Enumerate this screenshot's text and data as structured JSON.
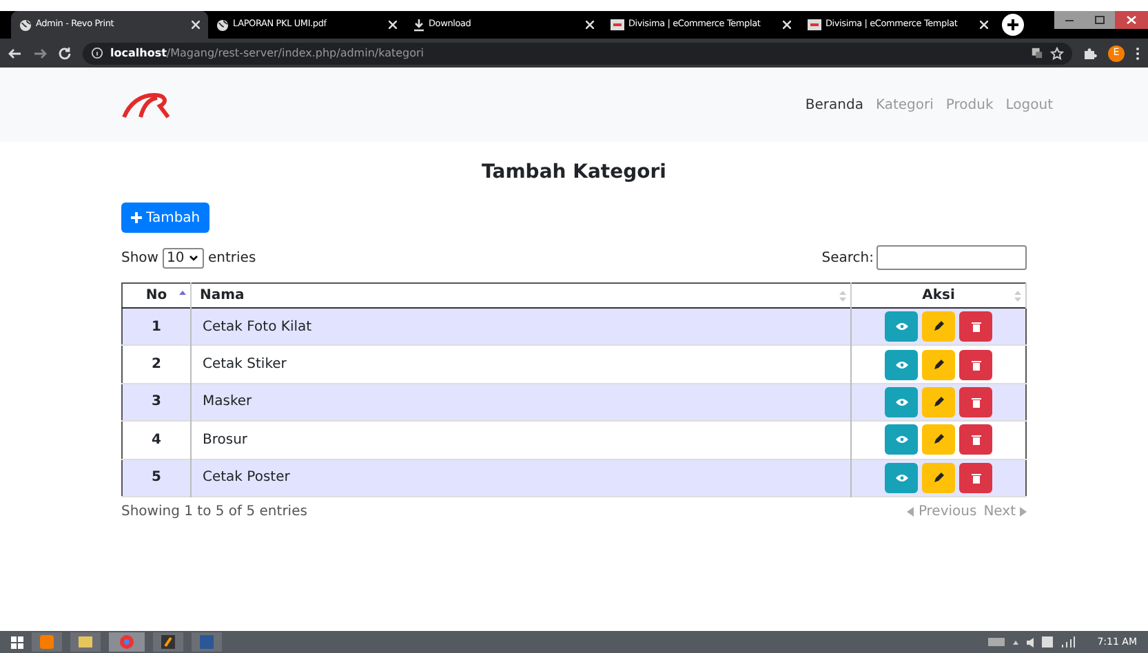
{
  "browser": {
    "tabs": [
      {
        "title": "Admin - Revo Print",
        "kind": "globe",
        "selected": true
      },
      {
        "title": "LAPORAN PKL UMI.pdf",
        "kind": "globe",
        "selected": false
      },
      {
        "title": "Download",
        "kind": "download",
        "selected": false
      },
      {
        "title": "Divisima | eCommerce Templat",
        "kind": "site",
        "selected": false
      },
      {
        "title": "Divisima | eCommerce Templat",
        "kind": "site",
        "selected": false
      }
    ],
    "url_host": "localhost",
    "url_path": "/Magang/rest-server/index.php/admin/kategori",
    "profile_initial": "E"
  },
  "navbar": {
    "links": [
      {
        "label": "Beranda",
        "selected": true
      },
      {
        "label": "Kategori",
        "selected": false
      },
      {
        "label": "Produk",
        "selected": false
      },
      {
        "label": "Logout",
        "selected": false
      }
    ]
  },
  "page_title": "Tambah Kategori",
  "add_button": "Tambah",
  "length": {
    "before": "Show",
    "value": "10",
    "after": "entries"
  },
  "search_label": "Search:",
  "table": {
    "columns": [
      "No",
      "Nama",
      "Aksi"
    ],
    "rows": [
      {
        "no": "1",
        "nama": "Cetak Foto Kilat"
      },
      {
        "no": "2",
        "nama": "Cetak Stiker"
      },
      {
        "no": "3",
        "nama": "Masker"
      },
      {
        "no": "4",
        "nama": "Brosur"
      },
      {
        "no": "5",
        "nama": "Cetak Poster"
      }
    ]
  },
  "info": "Showing 1 to 5 of 5 entries",
  "pagination": {
    "previous": "Previous",
    "next": "Next"
  },
  "taskbar": {
    "clock": "7:11 AM"
  }
}
